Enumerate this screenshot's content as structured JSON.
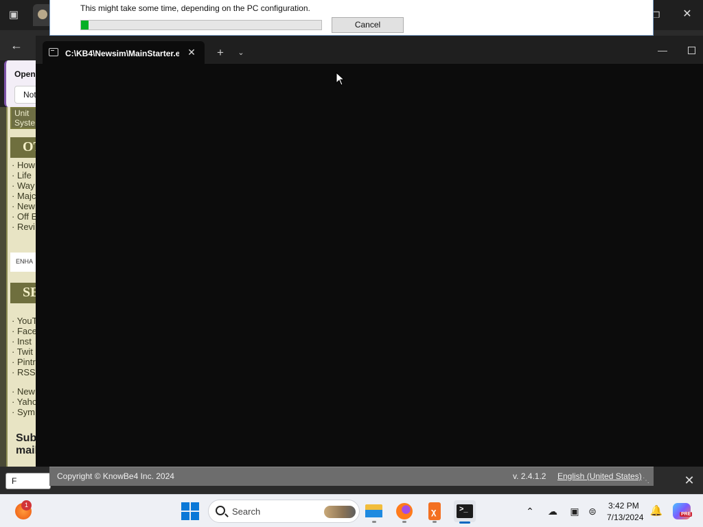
{
  "browser": {
    "popup": {
      "title": "Open",
      "button": "Not"
    },
    "sidebar": {
      "top_links": [
        "Unit",
        "Syste"
      ],
      "section1_heading": "OT",
      "section1_links": [
        "· How",
        "· Life",
        "· Way",
        "· Majc",
        "· New",
        "· Off E",
        "· Revi"
      ],
      "enhanced_label": "ENHA",
      "section2_heading": "SE",
      "section2_links": [
        "· YouT",
        "· Face",
        "· Inst",
        "· Twit",
        "· Pintr",
        "· RSS,"
      ],
      "section3_links": [
        "· New",
        "· Yaho",
        "· Sym"
      ],
      "subscribe_line1": "Sub",
      "subscribe_line2": "mail"
    },
    "find_value": "F"
  },
  "installer": {
    "message": "This might take some time, depending on the PC configuration.",
    "cancel_label": "Cancel",
    "progress": 0.03,
    "copyright": "Copyright © KnowBe4 Inc. 2024",
    "version": "v. 2.4.1.2",
    "language": "English (United States)"
  },
  "terminal": {
    "tab_title": "C:\\KB4\\Newsim\\MainStarter.e"
  },
  "taskbar": {
    "weather_badge": "1",
    "search_placeholder": "Search",
    "time": "3:42 PM",
    "date": "7/13/2024",
    "copilot_badge": "PRE"
  }
}
